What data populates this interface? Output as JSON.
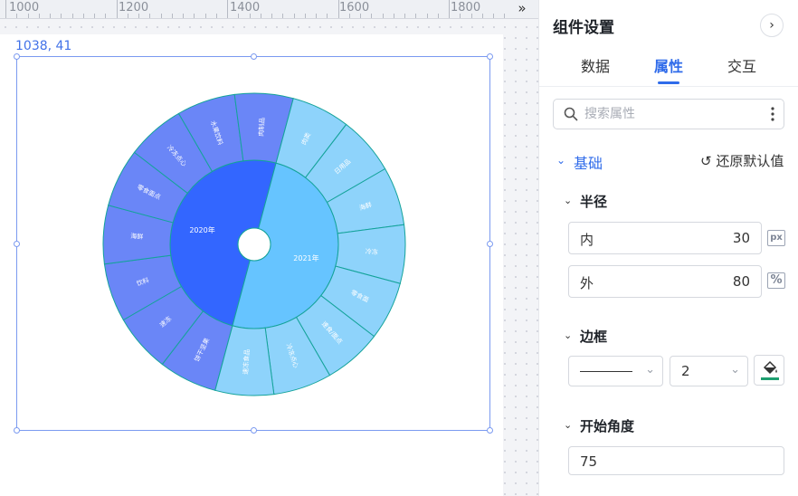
{
  "ruler": {
    "labels": [
      "1000",
      "1200",
      "1400",
      "1600",
      "1800"
    ],
    "collapse_icon": "double-chevron-right-icon"
  },
  "canvas": {
    "coord_label": "1038, 41"
  },
  "chart_data": {
    "type": "sunburst",
    "inner": [
      {
        "name": "2020年",
        "color": "#3366ff",
        "children": [
          "饼干坚果",
          "速冻",
          "饮料",
          "海鲜",
          "零食面点",
          "冷冻点心",
          "水果饮料",
          "肉制品"
        ]
      },
      {
        "name": "2021年",
        "color": "#66c4ff",
        "children": [
          "肉类",
          "日用品",
          "海鲜",
          "冷冻",
          "零食面",
          "速食/面点",
          "冷冻点心",
          "速冻食品"
        ]
      }
    ],
    "colors": {
      "outer_2020": "#6a86f7",
      "outer_2021": "#8ed3fb",
      "stroke": "#14a39a"
    }
  },
  "panel": {
    "title": "组件设置",
    "collapse_icon": "chevron-right-icon",
    "tabs": [
      "数据",
      "属性",
      "交互"
    ],
    "active_tab": "属性",
    "search_placeholder": "搜索属性",
    "section_basic": "基础",
    "reset_label": "还原默认值",
    "radius": {
      "label": "半径",
      "inner_label": "内",
      "inner_value": "30",
      "inner_unit": "px",
      "outer_label": "外",
      "outer_value": "80",
      "outer_unit": "%"
    },
    "border": {
      "label": "边框",
      "width_value": "2",
      "fill_color": "#1e9f70"
    },
    "start_angle": {
      "label": "开始角度",
      "value": "75"
    }
  }
}
